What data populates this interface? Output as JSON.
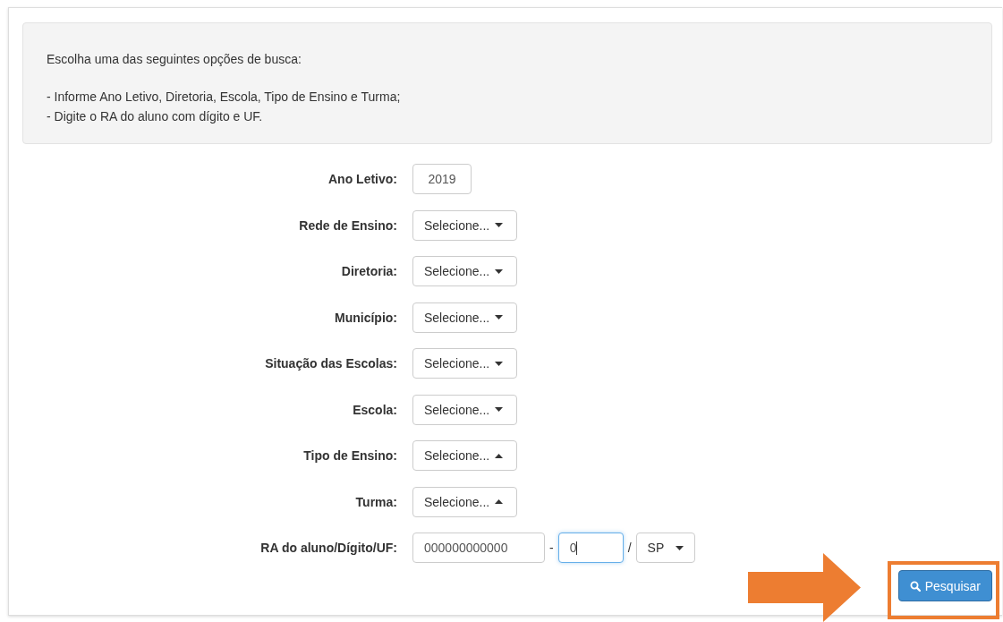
{
  "info": {
    "intro": "Escolha uma das seguintes opções de busca:",
    "lines": [
      "- Informe Ano Letivo, Diretoria, Escola, Tipo de Ensino e Turma;",
      "- Digite o RA do aluno com dígito e UF."
    ]
  },
  "fields": [
    {
      "label": "Ano Letivo:",
      "kind": "text",
      "value": "2019"
    },
    {
      "label": "Rede de Ensino:",
      "kind": "select",
      "value": "Selecione...",
      "expanded": false
    },
    {
      "label": "Diretoria:",
      "kind": "select",
      "value": "Selecione...",
      "expanded": false
    },
    {
      "label": "Município:",
      "kind": "select",
      "value": "Selecione...",
      "expanded": false
    },
    {
      "label": "Situação das Escolas:",
      "kind": "select",
      "value": "Selecione...",
      "expanded": false
    },
    {
      "label": "Escola:",
      "kind": "select",
      "value": "Selecione...",
      "expanded": false
    },
    {
      "label": "Tipo de Ensino:",
      "kind": "select",
      "value": "Selecione...",
      "expanded": true
    },
    {
      "label": "Turma:",
      "kind": "select",
      "value": "Selecione...",
      "expanded": true
    }
  ],
  "ra": {
    "label": "RA do aluno/Dígito/UF:",
    "number": "000000000000",
    "separator1": "-",
    "digit": "0",
    "digit_focused": true,
    "separator2": "/",
    "uf": "SP"
  },
  "search_button": {
    "label": "Pesquisar",
    "highlighted": true
  }
}
